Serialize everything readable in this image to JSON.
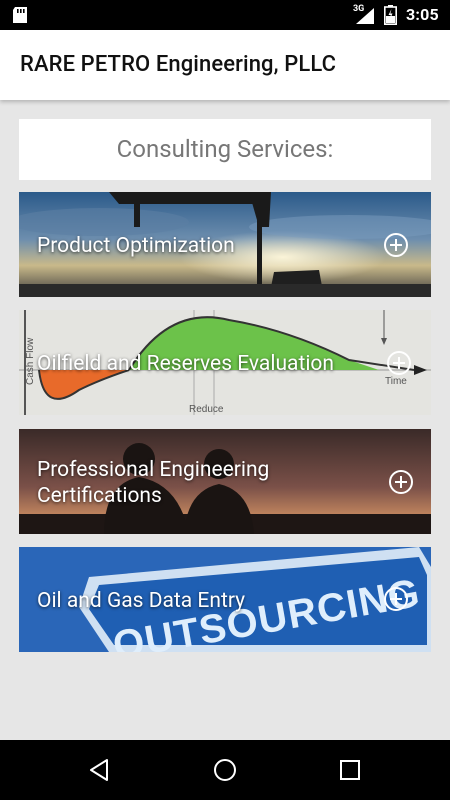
{
  "status_bar": {
    "time": "3:05",
    "signal_label": "3G",
    "icons": [
      "sd-card-icon",
      "signal-icon",
      "battery-icon"
    ]
  },
  "app_bar": {
    "title": "RARE PETRO Engineering, PLLC"
  },
  "services_header": {
    "title": "Consulting Services:"
  },
  "cards": [
    {
      "label": "Product Optimization",
      "icon": "plus-circle-icon"
    },
    {
      "label": "Oilfield and Reserves Evaluation",
      "icon": "plus-circle-icon",
      "image_text": {
        "axis_label": "Cash Flow",
        "time_label": "Time",
        "reduce_label": "Reduce"
      }
    },
    {
      "label_line1": "Professional Engineering",
      "label_line2": "Certifications",
      "icon": "plus-circle-icon"
    },
    {
      "label": "Oil and Gas Data Entry",
      "icon": "plus-circle-icon",
      "image_text": {
        "sign_text": "OUTSOURCING"
      }
    }
  ],
  "nav_bar": {
    "buttons": [
      "back-icon",
      "home-icon",
      "recents-icon"
    ]
  }
}
